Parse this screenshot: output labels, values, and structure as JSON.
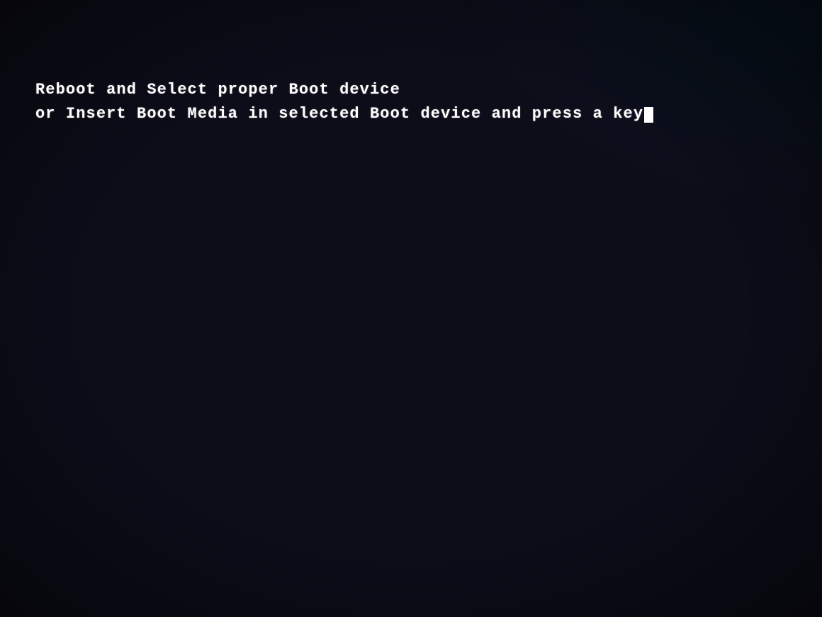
{
  "screen": {
    "background_color": "#0a0a14",
    "lines": [
      {
        "id": "line1",
        "text": "Reboot and Select proper Boot device"
      },
      {
        "id": "line2",
        "text": "or Insert Boot Media in selected Boot device and press a key"
      }
    ],
    "cursor_char": "_"
  }
}
